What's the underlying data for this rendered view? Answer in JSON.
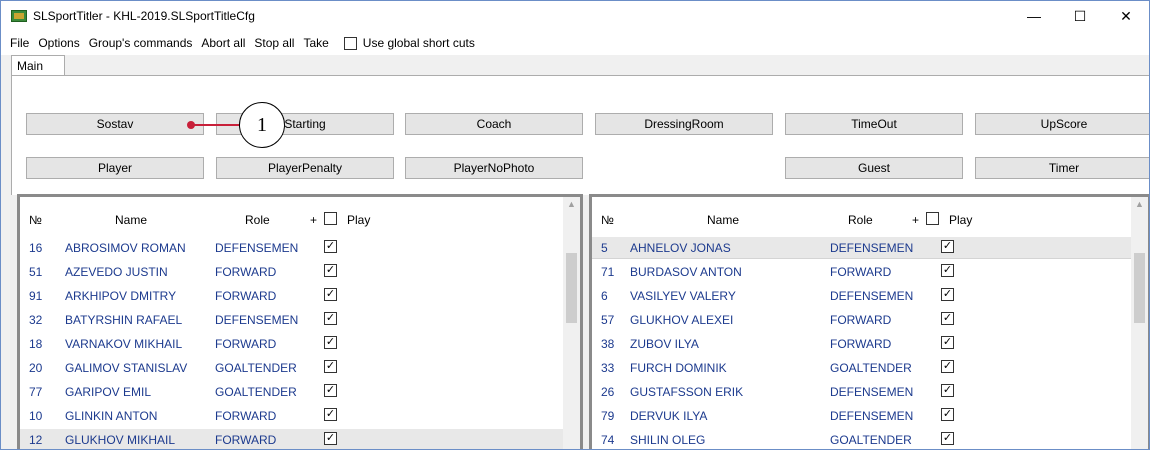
{
  "window": {
    "title": "SLSportTitler - KHL-2019.SLSportTitleCfg",
    "controls": [
      "—",
      "☐",
      "✕"
    ]
  },
  "menu": {
    "items": [
      "File",
      "Options",
      "Group's commands",
      "Abort all",
      "Stop all",
      "Take"
    ],
    "shortcut_label": "Use global short cuts"
  },
  "tabs": [
    "Main"
  ],
  "buttons": {
    "row1": [
      "Sostav",
      "Starting",
      "Coach",
      "DressingRoom",
      "TimeOut",
      "UpScore"
    ],
    "row2": [
      "Player",
      "PlayerPenalty",
      "PlayerNoPhoto",
      "Guest",
      "Timer"
    ]
  },
  "annotation": "1",
  "columns": {
    "no": "№",
    "name": "Name",
    "role": "Role",
    "plus": "+",
    "play": "Play"
  },
  "left_team": [
    {
      "no": "16",
      "name": "ABROSIMOV ROMAN",
      "role": "DEFENSEMEN",
      "play": true
    },
    {
      "no": "51",
      "name": "AZEVEDO JUSTIN",
      "role": "FORWARD",
      "play": true
    },
    {
      "no": "91",
      "name": "ARKHIPOV DMITRY",
      "role": "FORWARD",
      "play": true
    },
    {
      "no": "32",
      "name": "BATYRSHIN RAFAEL",
      "role": "DEFENSEMEN",
      "play": true
    },
    {
      "no": "18",
      "name": "VARNAKOV MIKHAIL",
      "role": "FORWARD",
      "play": true
    },
    {
      "no": "20",
      "name": "GALIMOV STANISLAV",
      "role": "GOALTENDER",
      "play": true
    },
    {
      "no": "77",
      "name": "GARIPOV EMIL",
      "role": "GOALTENDER",
      "play": true
    },
    {
      "no": "10",
      "name": "GLINKIN ANTON",
      "role": "FORWARD",
      "play": true
    },
    {
      "no": "12",
      "name": "GLUKHOV MIKHAIL",
      "role": "FORWARD",
      "play": true
    }
  ],
  "right_team": [
    {
      "no": "5",
      "name": "AHNELOV JONAS",
      "role": "DEFENSEMEN",
      "play": true
    },
    {
      "no": "71",
      "name": "BURDASOV ANTON",
      "role": "FORWARD",
      "play": true
    },
    {
      "no": "6",
      "name": "VASILYEV VALERY",
      "role": "DEFENSEMEN",
      "play": true
    },
    {
      "no": "57",
      "name": "GLUKHOV ALEXEI",
      "role": "FORWARD",
      "play": true
    },
    {
      "no": "38",
      "name": "ZUBOV ILYA",
      "role": "FORWARD",
      "play": true
    },
    {
      "no": "33",
      "name": "FURCH DOMINIK",
      "role": "GOALTENDER",
      "play": true
    },
    {
      "no": "26",
      "name": "GUSTAFSSON ERIK",
      "role": "DEFENSEMEN",
      "play": true
    },
    {
      "no": "79",
      "name": "DERVUK ILYA",
      "role": "DEFENSEMEN",
      "play": true
    },
    {
      "no": "74",
      "name": "SHILIN OLEG",
      "role": "GOALTENDER",
      "play": true
    }
  ],
  "left_selected_index": 8,
  "right_selected_index": 0
}
